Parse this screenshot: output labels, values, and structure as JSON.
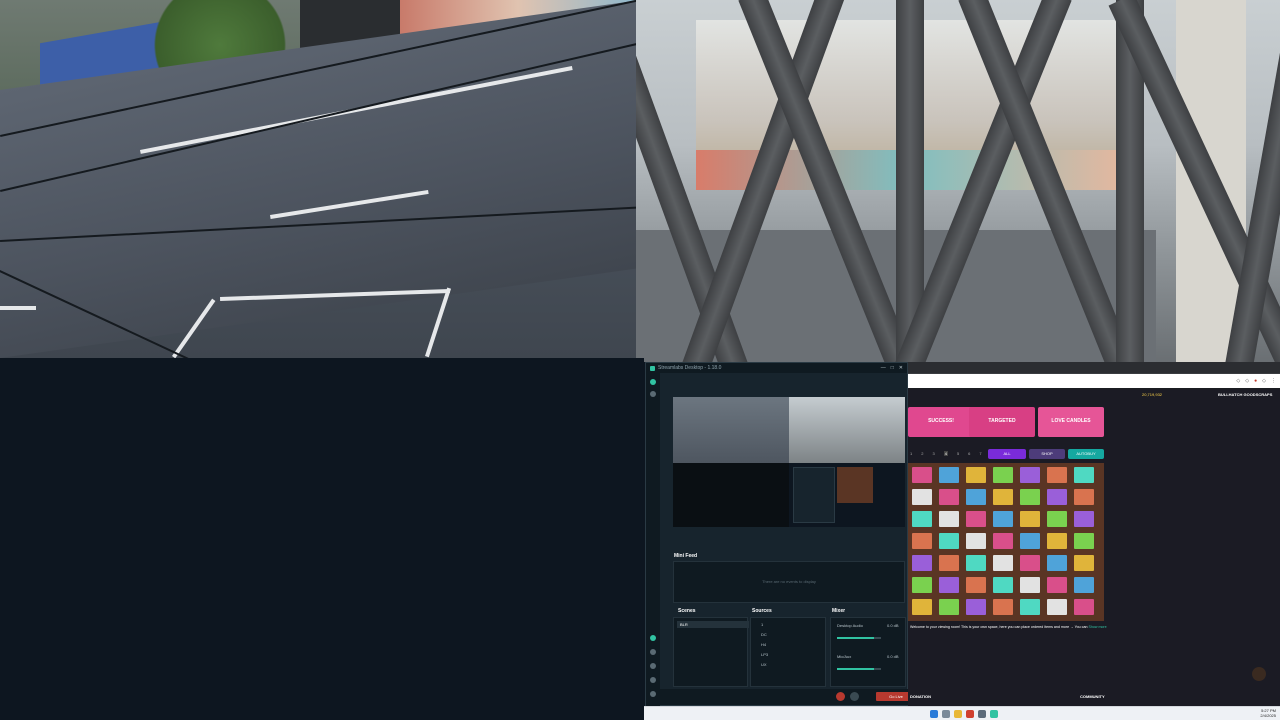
{
  "layout": {
    "quadrants": [
      "street-camera-feed",
      "window-camera-feed",
      "empty",
      "desktop-capture"
    ]
  },
  "streamlabs": {
    "title": "Streamlabs Desktop - 1.18.0",
    "window_controls": [
      "—",
      "□",
      "✕"
    ],
    "mini_feed": {
      "label": "Mini Feed",
      "empty_text": "There are no events to display"
    },
    "scenes": {
      "label": "Scenes",
      "items": [
        "BLR"
      ]
    },
    "sources": {
      "label": "Sources",
      "items": [
        "1",
        "DC",
        "H4",
        "LP3",
        "UX"
      ]
    },
    "mixer": {
      "label": "Mixer",
      "channels": [
        {
          "name": "Desktop Audio",
          "level": "0.0 dB",
          "volume": 0.85
        },
        {
          "name": "Mic/Aux",
          "level": "0.0 dB",
          "volume": 0.85
        }
      ]
    },
    "go_live_label": "Go Live"
  },
  "browser": {
    "banners": [
      {
        "text": "SUCCESS!",
        "color": "#e0488f"
      },
      {
        "text": "TARGETED",
        "color": "#d83f84"
      },
      {
        "text": "LOVE CANDLES",
        "color": "#e65597"
      }
    ],
    "page_numbers": [
      "1",
      "2",
      "3",
      "4",
      "5",
      "6",
      "7"
    ],
    "tabs": [
      {
        "label": "ALL",
        "color": "#7a2bd9"
      },
      {
        "label": "SHOP",
        "color": "#4d3c7a"
      },
      {
        "label": "AUTOBUY",
        "color": "#15a8a0"
      }
    ],
    "user_label": "BULLHATCH GOODSCRAPS",
    "coins": "20,719,932",
    "welcome_text": "Welcome to your viewing room! This is your own space, here you can place ordered items and more  → You can",
    "welcome_link": "Show more",
    "footer_left": "DONATION",
    "footer_right": "COMMUNITY"
  },
  "taskbar": {
    "time": "5:27 PM",
    "date": "2/4/2025"
  }
}
